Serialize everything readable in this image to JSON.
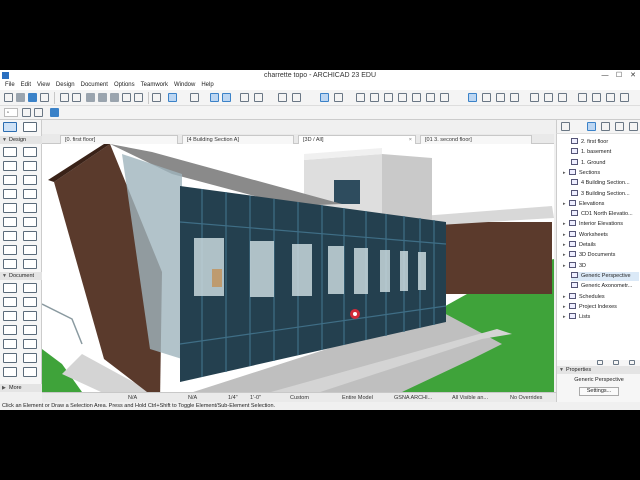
{
  "window": {
    "title": "charrette topo - ARCHICAD 23 EDU",
    "minimize": "—",
    "maximize": "☐",
    "close": "✕"
  },
  "menu": [
    "File",
    "Edit",
    "View",
    "Design",
    "Document",
    "Options",
    "Teamwork",
    "Window",
    "Help"
  ],
  "toolbox": {
    "design_header": "Design",
    "document_header": "Document",
    "more_label": "More"
  },
  "tabs": [
    {
      "label": "[0. first floor]"
    },
    {
      "label": "[4 Building Section A]"
    },
    {
      "label": "[3D / All]"
    },
    {
      "label": "[01 3. second floor]"
    }
  ],
  "navigator": {
    "items": [
      {
        "label": "2. first floor",
        "indent": 2
      },
      {
        "label": "1. basement",
        "indent": 2
      },
      {
        "label": "1. Ground",
        "indent": 2
      },
      {
        "label": "Sections",
        "indent": 1
      },
      {
        "label": "4 Building Section...",
        "indent": 2
      },
      {
        "label": "3 Building Section...",
        "indent": 2
      },
      {
        "label": "Elevations",
        "indent": 1
      },
      {
        "label": "CD1 North Elevatio...",
        "indent": 2
      },
      {
        "label": "Interior Elevations",
        "indent": 1
      },
      {
        "label": "Worksheets",
        "indent": 1
      },
      {
        "label": "Details",
        "indent": 1
      },
      {
        "label": "3D Documents",
        "indent": 1
      },
      {
        "label": "3D",
        "indent": 1
      },
      {
        "label": "Generic Perspective",
        "indent": 2,
        "selected": true
      },
      {
        "label": "Generic Axonometr...",
        "indent": 2
      },
      {
        "label": "Schedules",
        "indent": 1
      },
      {
        "label": "Project Indexes",
        "indent": 1
      },
      {
        "label": "Lists",
        "indent": 1
      }
    ]
  },
  "properties": {
    "header": "Properties",
    "view_name": "Generic Perspective",
    "settings_label": "Settings..."
  },
  "quick_options": {
    "scale": "1/4\"",
    "dim": "1'-0\"",
    "custom": "Custom",
    "model": "Entire Model",
    "penset": "GSNA ARCHI...",
    "layers": "All Visible an...",
    "override": "No Overrides",
    "na1": "N/A",
    "na2": "N/A"
  },
  "status": "Click an Element or Draw a Selection Area. Press and Hold Ctrl+Shift to Toggle Element/Sub-Element Selection.",
  "colors": {
    "sky": "#ffffff",
    "grass": "#3fa33a",
    "facade_glass": "#24404f",
    "wood": "#5a3a2c",
    "accent": "#3b82c8"
  }
}
